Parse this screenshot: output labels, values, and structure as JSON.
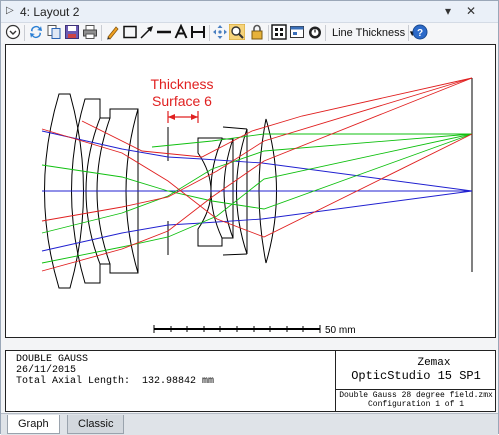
{
  "window": {
    "title": "4: Layout 2",
    "controls": {
      "dropdown": "▾",
      "close": "✕"
    }
  },
  "toolbar": {
    "line_thickness_label": "Line Thickness",
    "icons": [
      "settings-icon",
      "refresh-icon",
      "copy-icon",
      "save-icon",
      "print-icon",
      "pencil-icon",
      "rectangle-icon",
      "arrow-icon",
      "line-icon",
      "text-icon",
      "dimension-icon",
      "move-icon",
      "zoom-icon",
      "lock-icon",
      "fit-icon",
      "window-icon",
      "timer-icon",
      "help-icon"
    ]
  },
  "plot": {
    "annotation": {
      "line1": "Thickness",
      "line2": "Surface 6",
      "color": "#e02020"
    },
    "scale_bar_label": "50 mm",
    "ray_colors": {
      "field1": "#2020d0",
      "field2": "#10c010",
      "field3": "#e02020"
    }
  },
  "info": {
    "lens_name": "DOUBLE GAUSS",
    "date": "26/11/2015",
    "axial_length_label": "Total Axial Length:",
    "axial_length_value": "132.98842 mm",
    "company": "Zemax",
    "product": "OpticStudio 15 SP1",
    "file": "Double Gauss 28 degree field.zmx",
    "configuration": "Configuration 1 of 1"
  },
  "tabs": [
    {
      "label": "Graph",
      "active": true
    },
    {
      "label": "Classic",
      "active": false
    }
  ]
}
